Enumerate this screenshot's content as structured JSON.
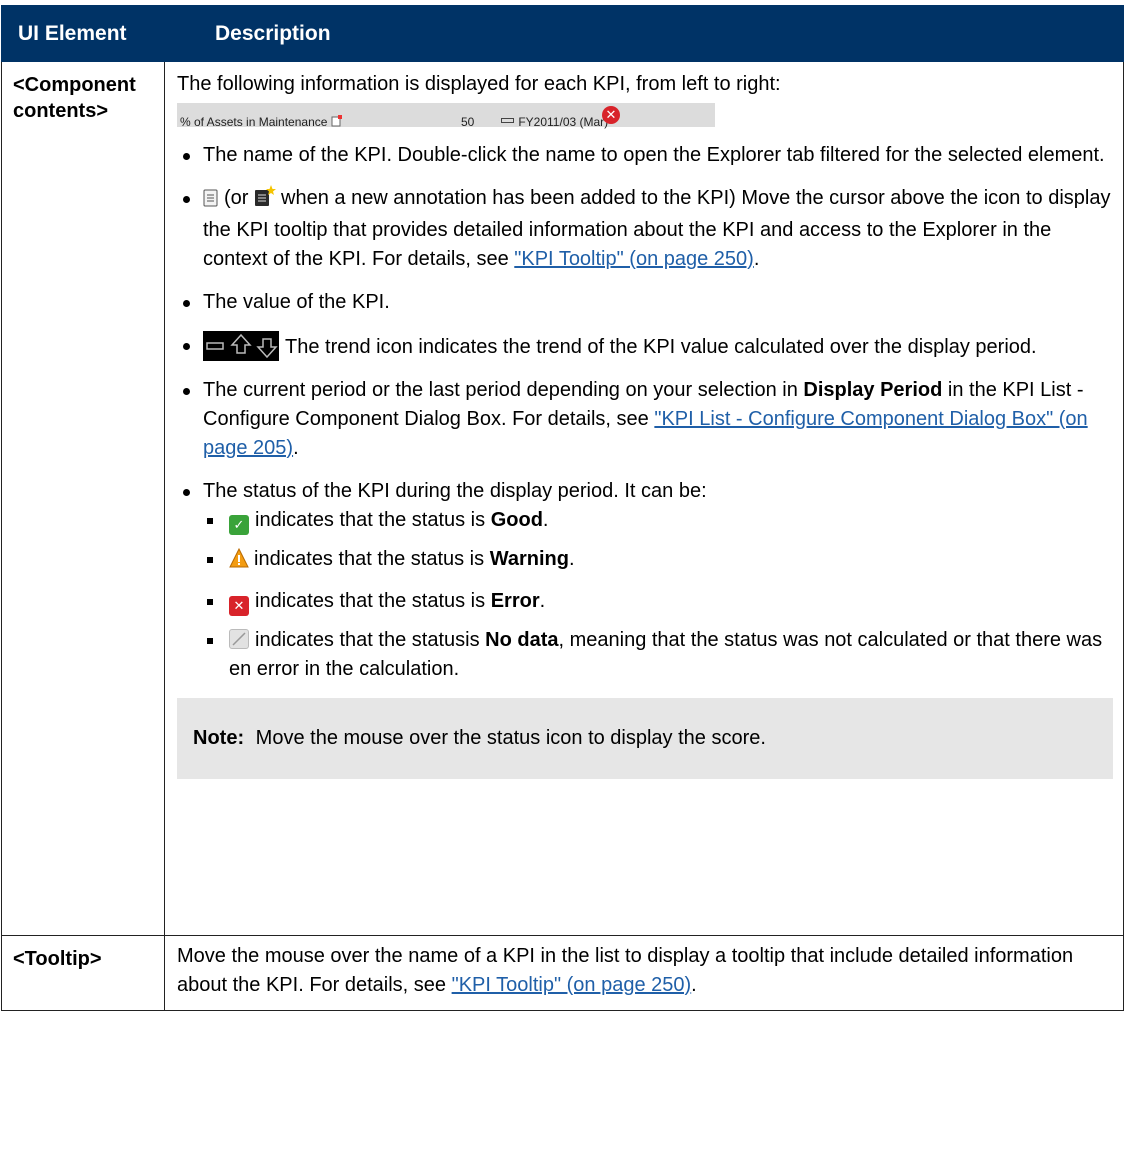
{
  "headers": {
    "element": "UI Element",
    "description": "Description"
  },
  "row1": {
    "element": "<Component contents>",
    "intro": "The following information is displayed for each KPI, from left to right:",
    "sample": {
      "name": "% of Assets in Maintenance",
      "value": "50",
      "period": "FY2011/03 (Mar)"
    },
    "bullet_name": "The name of the KPI. Double-click the name to open the Explorer tab filtered for the selected element.",
    "bullet_tooltip_a": "(or",
    "bullet_tooltip_b": "when a new annotation has been added to the KPI) Move the cursor above the icon to display the KPI tooltip that provides detailed information about the KPI and access to the Explorer in the context of the KPI. For details, see",
    "bullet_tooltip_link": "\"KPI Tooltip\" (on page 250)",
    "bullet_value": "The value of the KPI.",
    "bullet_trend": "The trend icon indicates the trend of the KPI value calculated over the display period.",
    "bullet_period_a": "The current period or the last period depending on your selection in",
    "bullet_period_bold": "Display Period",
    "bullet_period_b": "in the KPI List - Configure Component Dialog Box. For details, see",
    "bullet_period_link": "\"KPI List - Configure Component Dialog Box\" (on page 205)",
    "bullet_status": "The status of the KPI during the display period. It can be:",
    "status_items": [
      {
        "pre": "indicates that the status is",
        "bold": "Good",
        "post": "."
      },
      {
        "pre": "indicates that the status is",
        "bold": "Warning",
        "post": "."
      },
      {
        "pre": "indicates that the status is",
        "bold": "Error",
        "post": "."
      },
      {
        "pre": "indicates that the statusis",
        "bold": "No data",
        "post": ", meaning that the status was not calculated or that there was en error in the calculation."
      }
    ],
    "note_label": "Note:",
    "note_text": "Move the mouse over the status icon to display the score."
  },
  "row2": {
    "element": "<Tooltip>",
    "text": "Move the mouse over the name of a KPI in the list to display a tooltip that include detailed information about the KPI. For details, see",
    "link": "\"KPI Tooltip\" (on page 250)"
  },
  "colors": {
    "header_bg": "#003366",
    "link": "#1f5fa8",
    "good": "#3aa33a",
    "error": "#d8232a",
    "warning": "#f39c12"
  },
  "icons": [
    "annotation-icon",
    "new-annotation-icon",
    "trend-icons",
    "good-status-icon",
    "warning-status-icon",
    "error-status-icon",
    "no-data-status-icon"
  ]
}
